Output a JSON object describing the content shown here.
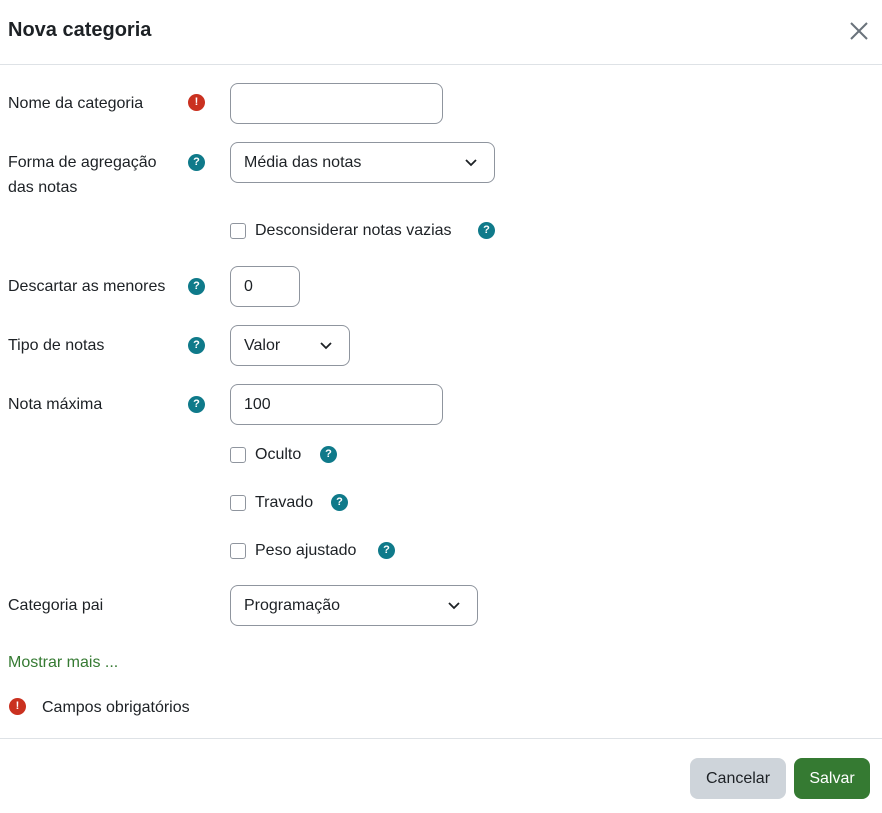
{
  "dialog": {
    "title": "Nova categoria",
    "close_label": "×"
  },
  "fields": {
    "category_name": {
      "label": "Nome da categoria",
      "value": ""
    },
    "aggregation": {
      "label_line1": "Forma de agregação",
      "label_line2": "das notas",
      "selected": "Média das notas"
    },
    "exclude_empty": {
      "label": "Desconsiderar notas vazias",
      "checked": false
    },
    "drop_lowest": {
      "label": "Descartar as menores",
      "value": "0"
    },
    "grade_type": {
      "label": "Tipo de notas",
      "selected": "Valor"
    },
    "max_grade": {
      "label": "Nota máxima",
      "value": "100"
    },
    "hidden": {
      "label": "Oculto",
      "checked": false
    },
    "locked": {
      "label": "Travado",
      "checked": false
    },
    "weight_adjusted": {
      "label": "Peso ajustado",
      "checked": false
    },
    "parent_category": {
      "label": "Categoria pai",
      "selected": "Programação"
    }
  },
  "show_more": "Mostrar mais ...",
  "required_note": "Campos obrigatórios",
  "icons": {
    "required": "!",
    "help": "?"
  },
  "footer": {
    "cancel_label": "Cancelar",
    "save_label": "Salvar"
  },
  "colors": {
    "required": "#ca3120",
    "help": "#0f7a8a",
    "primary": "#357a32",
    "secondary": "#ced4da"
  }
}
